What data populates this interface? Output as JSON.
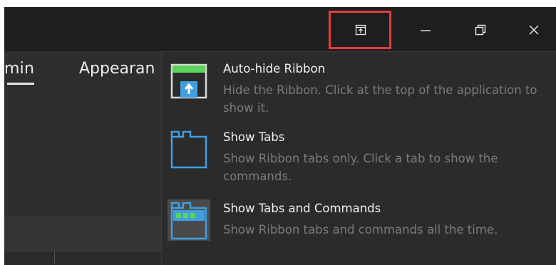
{
  "ribbon": {
    "tabs": [
      {
        "label": "min"
      },
      {
        "label": "Appearan"
      }
    ]
  },
  "window_controls": {
    "ribbon_display_options": "ribbon-display-options-icon",
    "minimize": "minimize-icon",
    "restore": "restore-icon",
    "close": "close-icon"
  },
  "colors": {
    "accent_blue": "#3f9fe0",
    "accent_green": "#5bd25b",
    "highlight_red": "#e63b3b"
  },
  "menu": {
    "items": [
      {
        "title": "Auto-hide Ribbon",
        "description": "Hide the Ribbon. Click at the top of the application to show it.",
        "icon": "auto-hide-ribbon-icon"
      },
      {
        "title": "Show Tabs",
        "description": "Show Ribbon tabs only. Click a tab to show the commands.",
        "icon": "show-tabs-icon"
      },
      {
        "title": "Show Tabs and Commands",
        "description": "Show Ribbon tabs and commands all the time.",
        "icon": "show-tabs-and-commands-icon"
      }
    ]
  }
}
